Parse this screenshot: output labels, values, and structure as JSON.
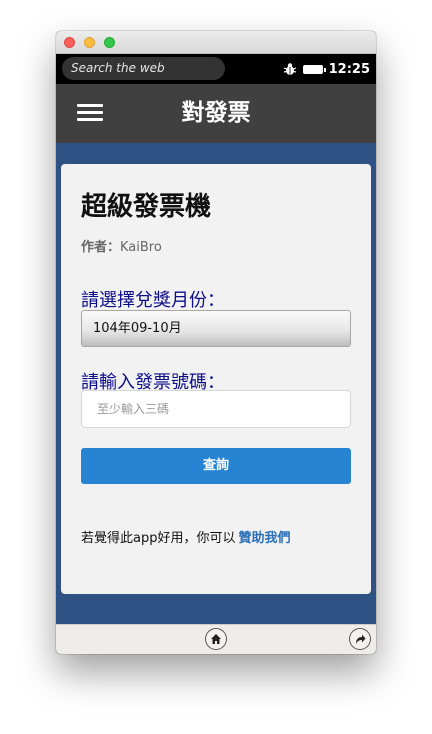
{
  "status_bar": {
    "search_placeholder": "Search the web",
    "time": "12:25",
    "icons": [
      "bug-icon",
      "battery-icon"
    ]
  },
  "app_bar": {
    "title": "對發票",
    "menu_icon": "hamburger-menu-icon"
  },
  "card": {
    "title": "超級發票機",
    "author_label": "作者：",
    "author_name": "KaiBro",
    "month_label": "請選擇兌獎月份：",
    "month_selected": "104年09-10月",
    "number_label": "請輸入發票號碼：",
    "number_placeholder": "至少輸入三碼",
    "number_value": "",
    "query_button": "查詢",
    "sponsor_text": "若覺得此app好用，你可以",
    "sponsor_link": "贊助我們"
  },
  "bottom_bar": {
    "icons": [
      "home-icon",
      "share-icon"
    ]
  },
  "colors": {
    "app_background": "#2f5285",
    "app_bar": "#404040",
    "card": "#f2f2f2",
    "label_text": "#0d0d8a",
    "button": "#2684d3",
    "link": "#2c6fb4"
  }
}
